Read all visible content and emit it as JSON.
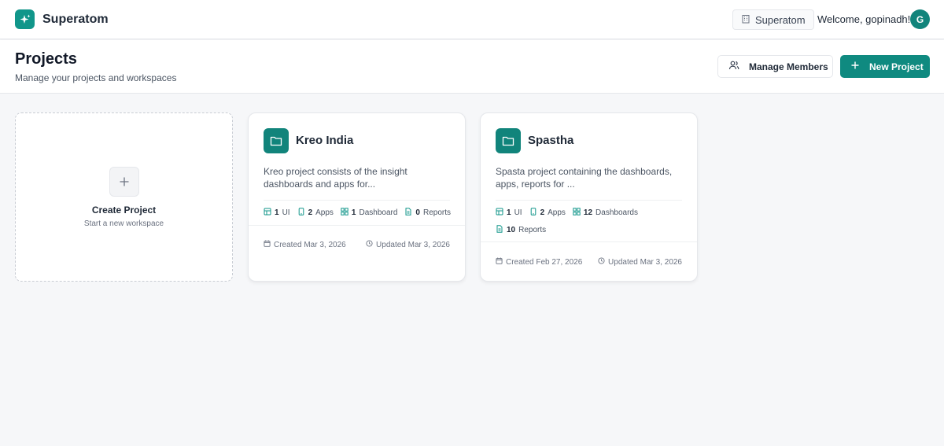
{
  "topbar": {
    "brand_name": "Superatom",
    "org_name": "Superatom",
    "welcome_text": "Welcome, gopinadh!",
    "avatar_initial": "G"
  },
  "header": {
    "title": "Projects",
    "subtitle": "Manage your projects and workspaces",
    "manage_members_label": "Manage Members",
    "new_project_label": "New Project"
  },
  "create_card": {
    "title": "Create Project",
    "subtitle": "Start a new workspace"
  },
  "projects": [
    {
      "name": "Kreo India",
      "description": "Kreo project consists of the insight dashboards and apps for...",
      "stats": [
        {
          "icon": "ui-icon",
          "count": "1",
          "label": "UI"
        },
        {
          "icon": "app-icon",
          "count": "2",
          "label": "Apps"
        },
        {
          "icon": "dashboard-icon",
          "count": "1",
          "label": "Dashboard"
        },
        {
          "icon": "report-icon",
          "count": "0",
          "label": "Reports"
        }
      ],
      "created": "Created Mar 3, 2026",
      "updated": "Updated Mar 3, 2026"
    },
    {
      "name": "Spastha",
      "description": "Spasta project containing the dashboards, apps, reports for ...",
      "stats": [
        {
          "icon": "ui-icon",
          "count": "1",
          "label": "UI"
        },
        {
          "icon": "app-icon",
          "count": "2",
          "label": "Apps"
        },
        {
          "icon": "dashboard-icon",
          "count": "12",
          "label": "Dashboards"
        },
        {
          "icon": "report-icon",
          "count": "10",
          "label": "Reports"
        }
      ],
      "created": "Created Feb 27, 2026",
      "updated": "Updated Mar 3, 2026"
    }
  ],
  "colors": {
    "accent": "#0f8a80",
    "background": "#f6f7f9"
  }
}
